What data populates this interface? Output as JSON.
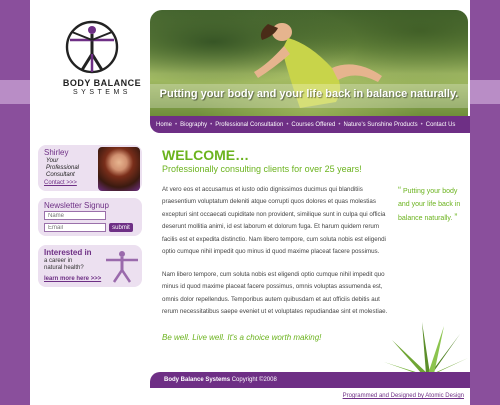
{
  "brand": {
    "name": "BODY BALANCE",
    "sub": "SYSTEMS"
  },
  "hero": {
    "tagline": "Putting your body and your life back in balance naturally."
  },
  "nav": {
    "items": [
      "Home",
      "Biography",
      "Professional Consultation",
      "Courses Offered",
      "Nature's Sunshine Products",
      "Contact Us"
    ]
  },
  "sidebar": {
    "shirley": {
      "name": "Shirley",
      "role_line1": "Your",
      "role_line2": "Professional",
      "role_line3": "Consultant",
      "contact": "Contact >>>"
    },
    "newsletter": {
      "title": "Newsletter Signup",
      "name_placeholder": "Name",
      "email_placeholder": "Email",
      "submit": "submit"
    },
    "health": {
      "title": "Interested in",
      "line1": "a career in",
      "line2": "natural health?",
      "more": "learn more here >>>"
    }
  },
  "main": {
    "welcome": "WELCOME…",
    "subhead": "Professionally consulting clients for over 25 years!",
    "para1": "At vero eos et accusamus et iusto odio dignissimos ducimus qui blanditiis praesentium voluptatum deleniti atque corrupti quos dolores et quas molestias excepturi sint occaecati cupiditate non provident, similique sunt in culpa qui officia deserunt mollitia animi, id est laborum et dolorum fuga. Et harum quidem rerum facilis est et expedita distinctio. Nam libero tempore, cum soluta nobis est eligendi optio cumque nihil impedit quo minus id quod maxime placeat facere possimus.",
    "para2": "Nam libero tempore, cum soluta nobis est eligendi optio cumque nihil impedit quo minus id quod maxime placeat facere possimus, omnis voluptas assumenda est, omnis dolor repellendus. Temporibus autem quibusdam et aut officiis debitis aut rerum necessitatibus saepe eveniet ut et voluptates repudiandae sint et molestiae.",
    "closing": "Be well. Live well. It's a choice worth making!",
    "quote_open": "“",
    "quote": "Putting your body and your life back in balance naturally.",
    "quote_close": "”"
  },
  "footer": {
    "brand": "Body Balance Systems",
    "copyright": " Copyright ©2008",
    "credit": "Programmed and Designed by Atomic Design"
  },
  "colors": {
    "purple": "#6e2f85",
    "green": "#6bb31e",
    "background": "#8a4f9c"
  }
}
